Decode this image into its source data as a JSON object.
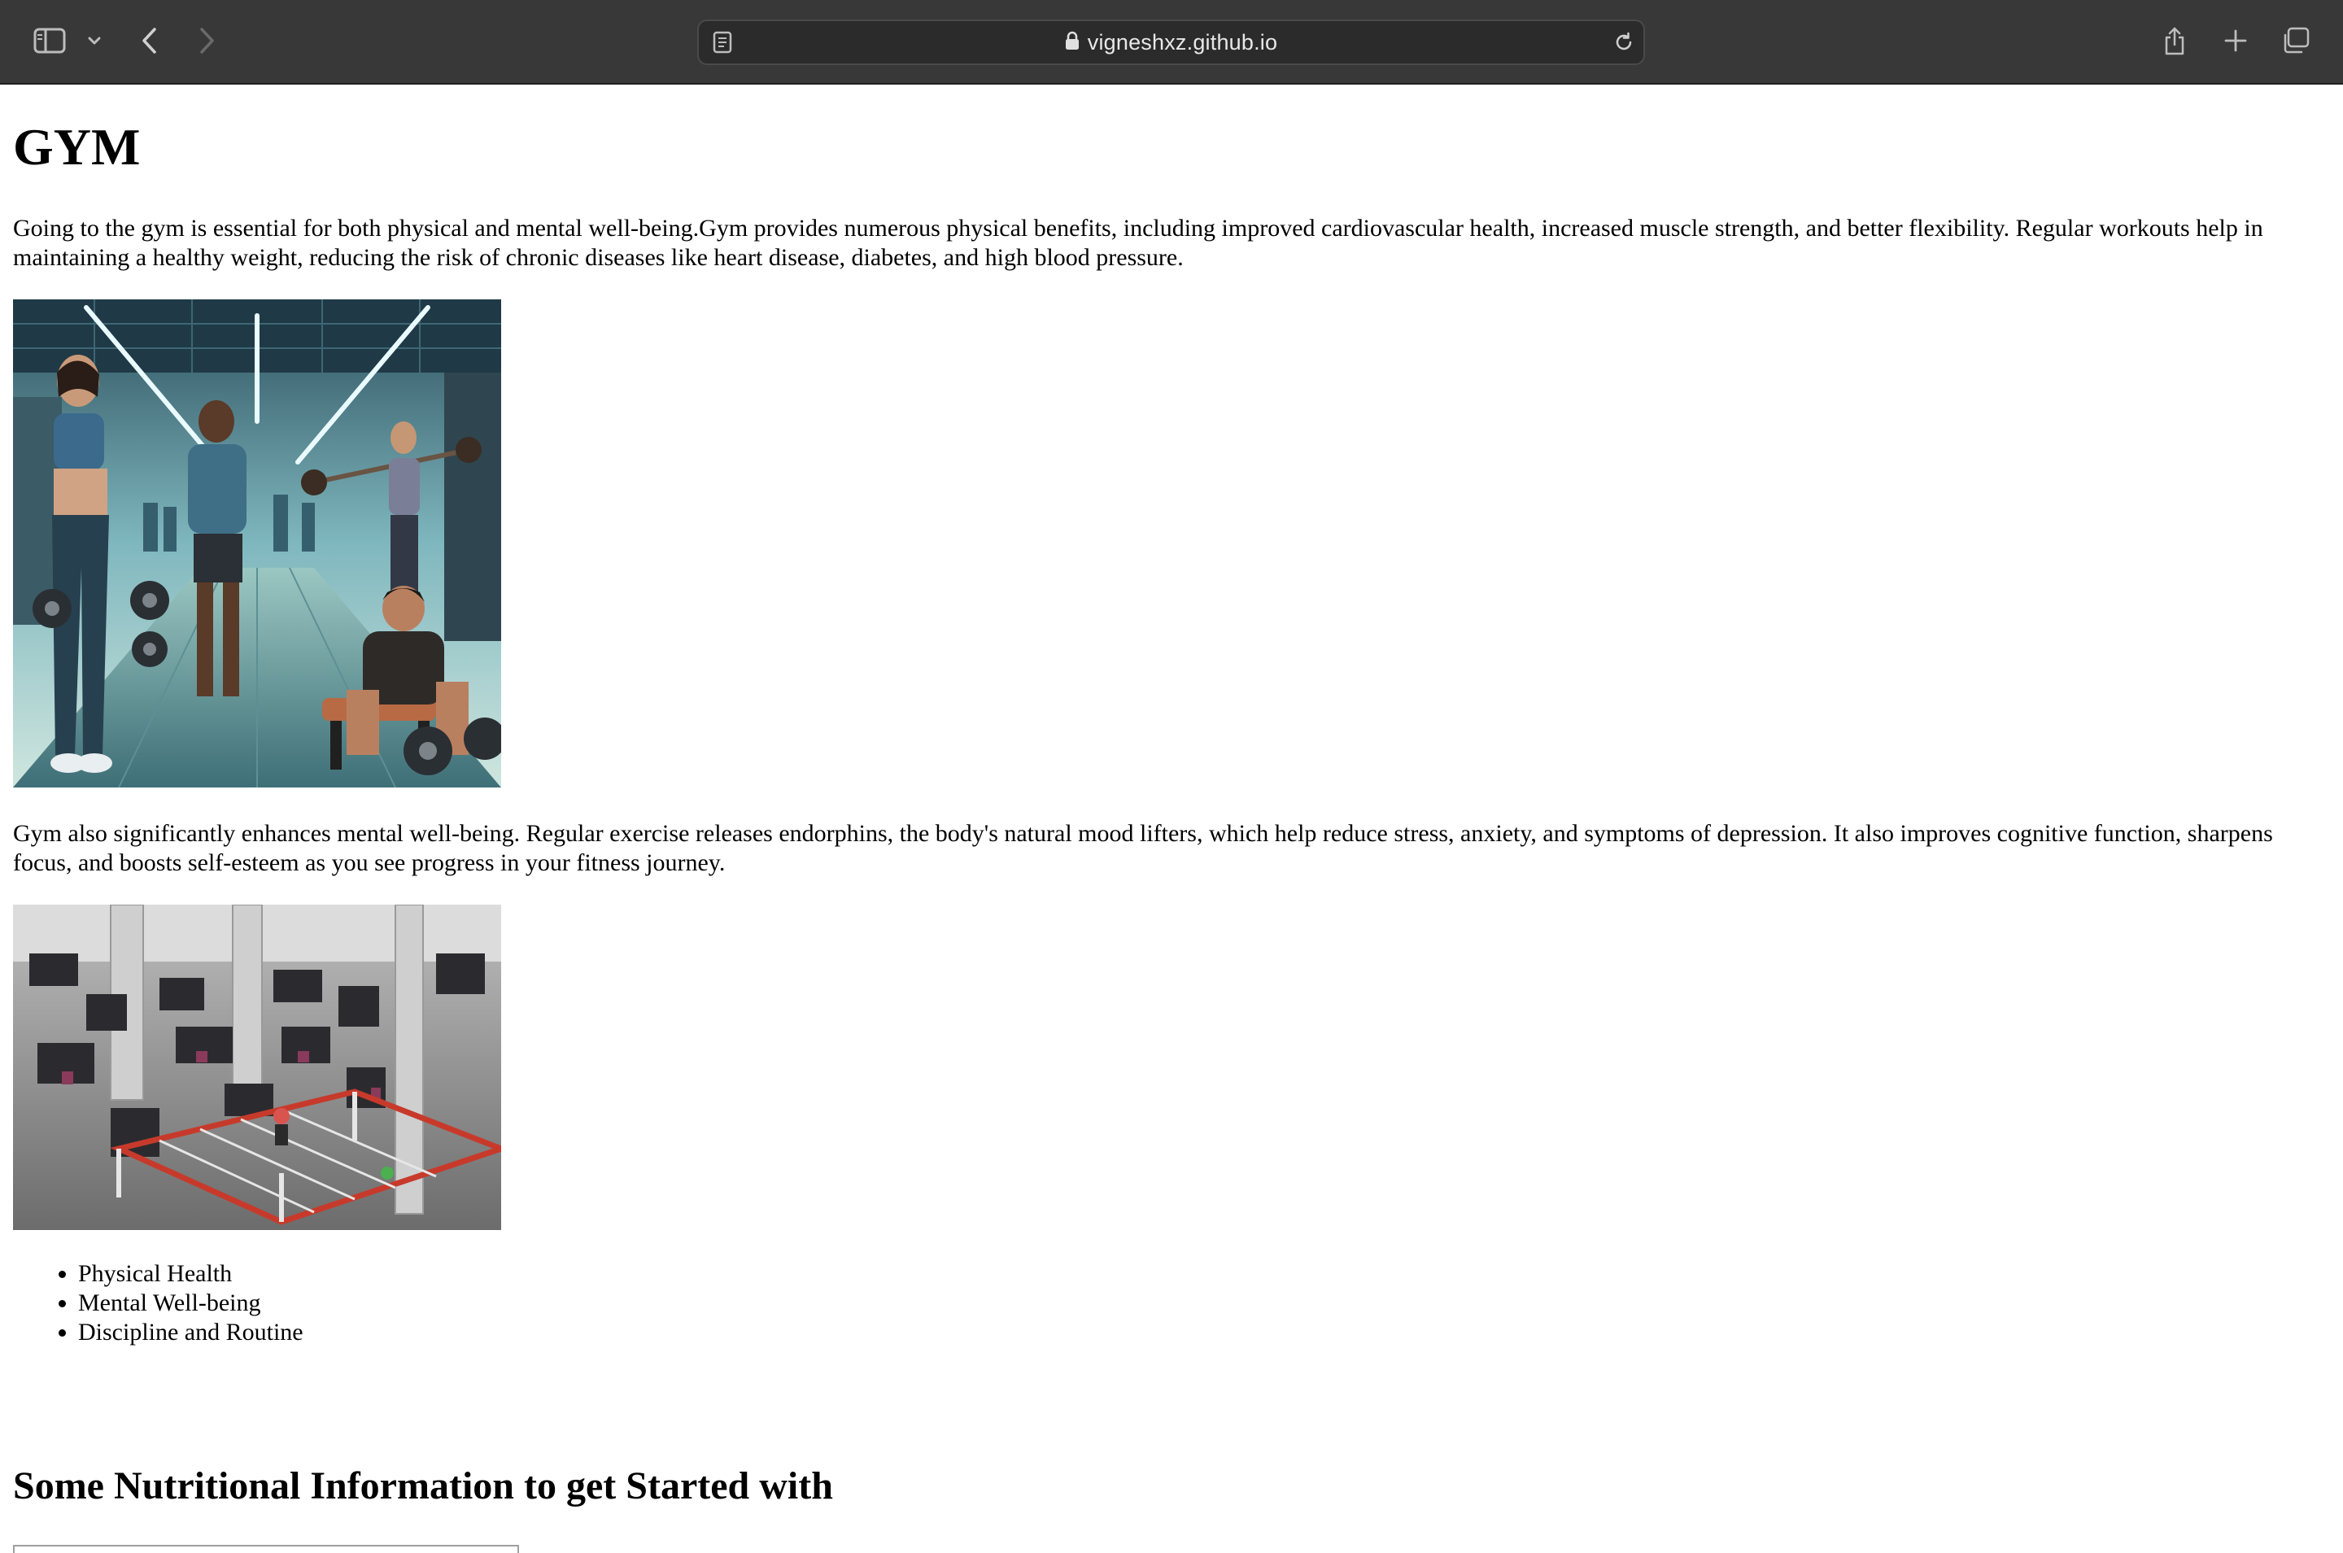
{
  "browser": {
    "url": "vigneshxz.github.io",
    "icons": [
      "sidebar-icon",
      "chevron-down-icon",
      "back-icon",
      "forward-icon",
      "reader-icon",
      "lock-icon",
      "reload-icon",
      "share-icon",
      "new-tab-icon",
      "tabs-overview-icon"
    ],
    "toolbar_color": "#383838"
  },
  "page": {
    "title": "GYM",
    "intro": "Going to the gym is essential for both physical and mental well-being.Gym provides numerous physical benefits, including improved cardiovascular health, increased muscle strength, and better flexibility. Regular workouts help in maintaining a healthy weight, reducing the risk of chronic diseases like heart disease, diabetes, and high blood pressure.",
    "mental": "Gym also significantly enhances mental well-being. Regular exercise releases endorphins, the body's natural mood lifters, which help reduce stress, anxiety, and symptoms of depression. It also improves cognitive function, sharpens focus, and boosts self-esteem as you see progress in your fitness journey.",
    "benefits": [
      "Physical Health",
      "Mental Well-being",
      "Discipline and Routine"
    ],
    "nutrition_heading": "Some Nutritional Information to get Started with"
  }
}
